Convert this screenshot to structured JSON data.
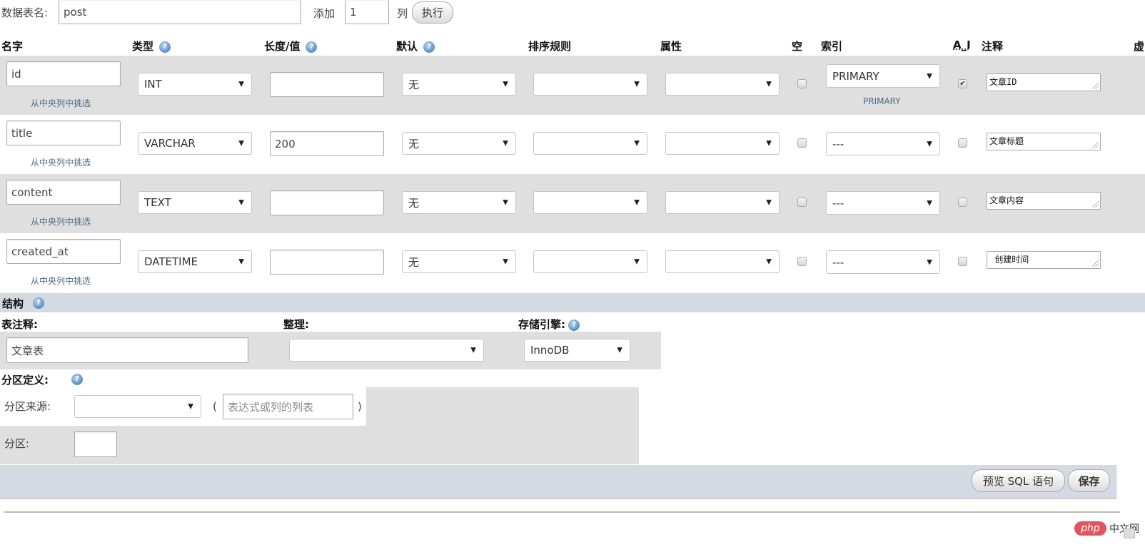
{
  "top": {
    "table_name_label": "数据表名:",
    "table_name_value": "post",
    "add_label": "添加",
    "add_count": "1",
    "columns_label": "列",
    "execute_button": "执行"
  },
  "headers": {
    "name": "名字",
    "type": "类型",
    "length": "长度/值",
    "default": "默认",
    "collation": "排序规则",
    "attributes": "属性",
    "null": "空",
    "index": "索引",
    "ai": "A_I",
    "comment": "注释",
    "extra": "虚"
  },
  "pick_from_central": "从中央列中挑选",
  "rows": [
    {
      "name": "id",
      "type": "INT",
      "length": "",
      "default": "无",
      "collation": "",
      "attributes": "",
      "null": false,
      "index": "PRIMARY",
      "index_sub": "PRIMARY",
      "ai": true,
      "comment": "文章ID"
    },
    {
      "name": "title",
      "type": "VARCHAR",
      "length": "200",
      "default": "无",
      "collation": "",
      "attributes": "",
      "null": false,
      "index": "---",
      "index_sub": "",
      "ai": false,
      "comment": "文章标题"
    },
    {
      "name": "content",
      "type": "TEXT",
      "length": "",
      "default": "无",
      "collation": "",
      "attributes": "",
      "null": false,
      "index": "---",
      "index_sub": "",
      "ai": false,
      "comment": "文章内容"
    },
    {
      "name": "created_at",
      "type": "DATETIME",
      "length": "",
      "default": "无",
      "collation": "",
      "attributes": "",
      "null": false,
      "index": "---",
      "index_sub": "",
      "ai": false,
      "comment": " 创建时间"
    }
  ],
  "structure": {
    "title": "结构",
    "table_comment_label": "表注释:",
    "table_comment_value": "文章表",
    "collation_label": "整理:",
    "collation_value": "",
    "engine_label": "存储引擎:",
    "engine_value": "InnoDB"
  },
  "partition": {
    "title": "分区定义:",
    "by_label": "分区来源:",
    "by_value": "",
    "open_paren": "(",
    "expr_placeholder": "表达式或列的列表",
    "close_paren": ")",
    "partitions_label": "分区:",
    "partitions_value": ""
  },
  "footer": {
    "preview_sql_button": "预览 SQL 语句",
    "save_button": "保存"
  },
  "watermark": "中文网",
  "watermark_logo": "php"
}
